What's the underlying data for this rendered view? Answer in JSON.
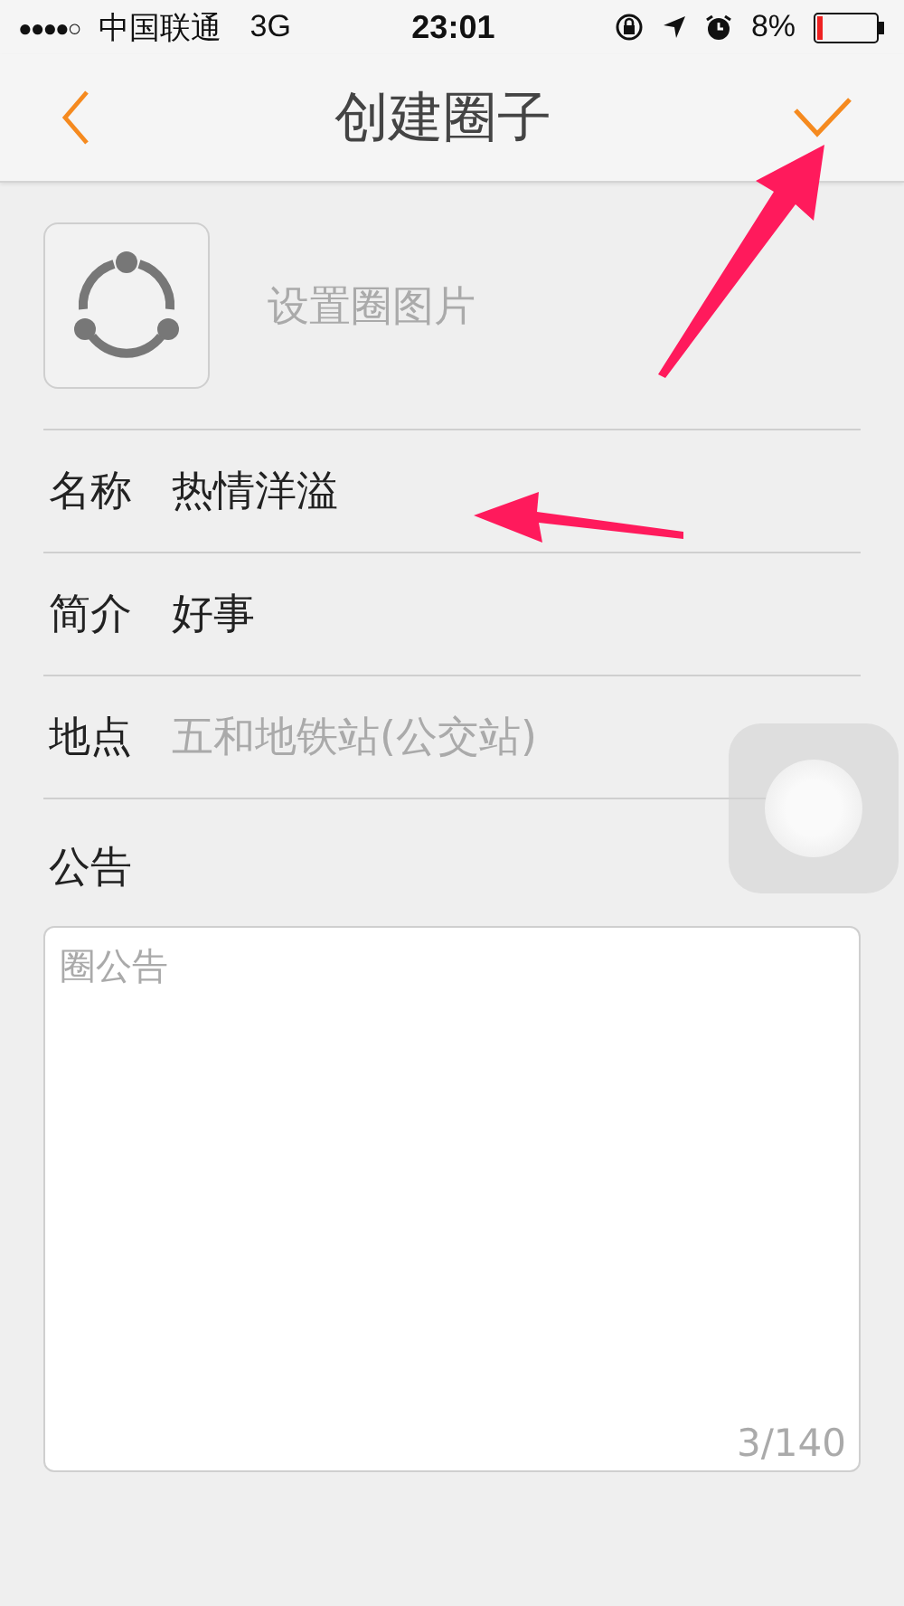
{
  "status_bar": {
    "signal": "●●●●○",
    "carrier": "中国联通",
    "network": "3G",
    "time": "23:01",
    "battery": "8%"
  },
  "nav": {
    "title": "创建圈子"
  },
  "photo": {
    "label": "设置圈图片"
  },
  "fields": [
    {
      "label": "名称",
      "value": "热情洋溢"
    },
    {
      "label": "简介",
      "value": "好事"
    },
    {
      "label": "地点",
      "placeholder": "五和地铁站(公交站)"
    }
  ],
  "announcement": {
    "label": "公告",
    "placeholder": "圈公告",
    "counter": "3/140"
  }
}
